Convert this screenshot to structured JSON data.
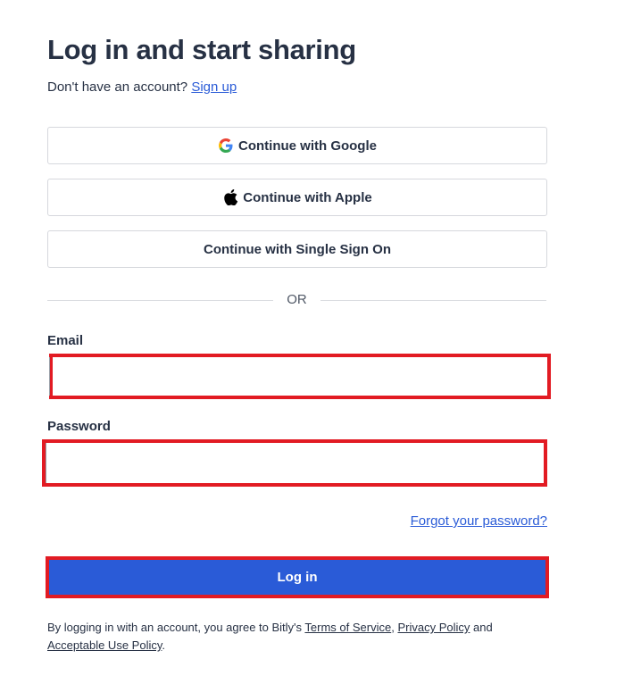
{
  "page": {
    "title": "Log in and start sharing",
    "signup_prompt": "Don't have an account?",
    "signup_link": "Sign up"
  },
  "social_buttons": {
    "google_label": "Continue with Google",
    "google_icon": "google-icon",
    "apple_label": "Continue with Apple",
    "apple_icon": "apple-icon",
    "sso_label": "Continue with Single Sign On"
  },
  "divider": {
    "text": "OR"
  },
  "form": {
    "email_label": "Email",
    "email_value": "",
    "password_label": "Password",
    "password_value": "",
    "forgot_link": "Forgot your password?",
    "login_button": "Log in"
  },
  "legal": {
    "prefix": "By logging in with an account, you agree to Bitly's ",
    "terms": "Terms of Service",
    "sep1": ", ",
    "privacy": "Privacy Policy",
    "and": " and ",
    "acceptable_use": "Acceptable Use Policy",
    "suffix": "."
  },
  "colors": {
    "primary": "#2a5bd7",
    "text": "#273144",
    "highlight_border": "#e21b23",
    "button_border": "#d6d8dd"
  }
}
